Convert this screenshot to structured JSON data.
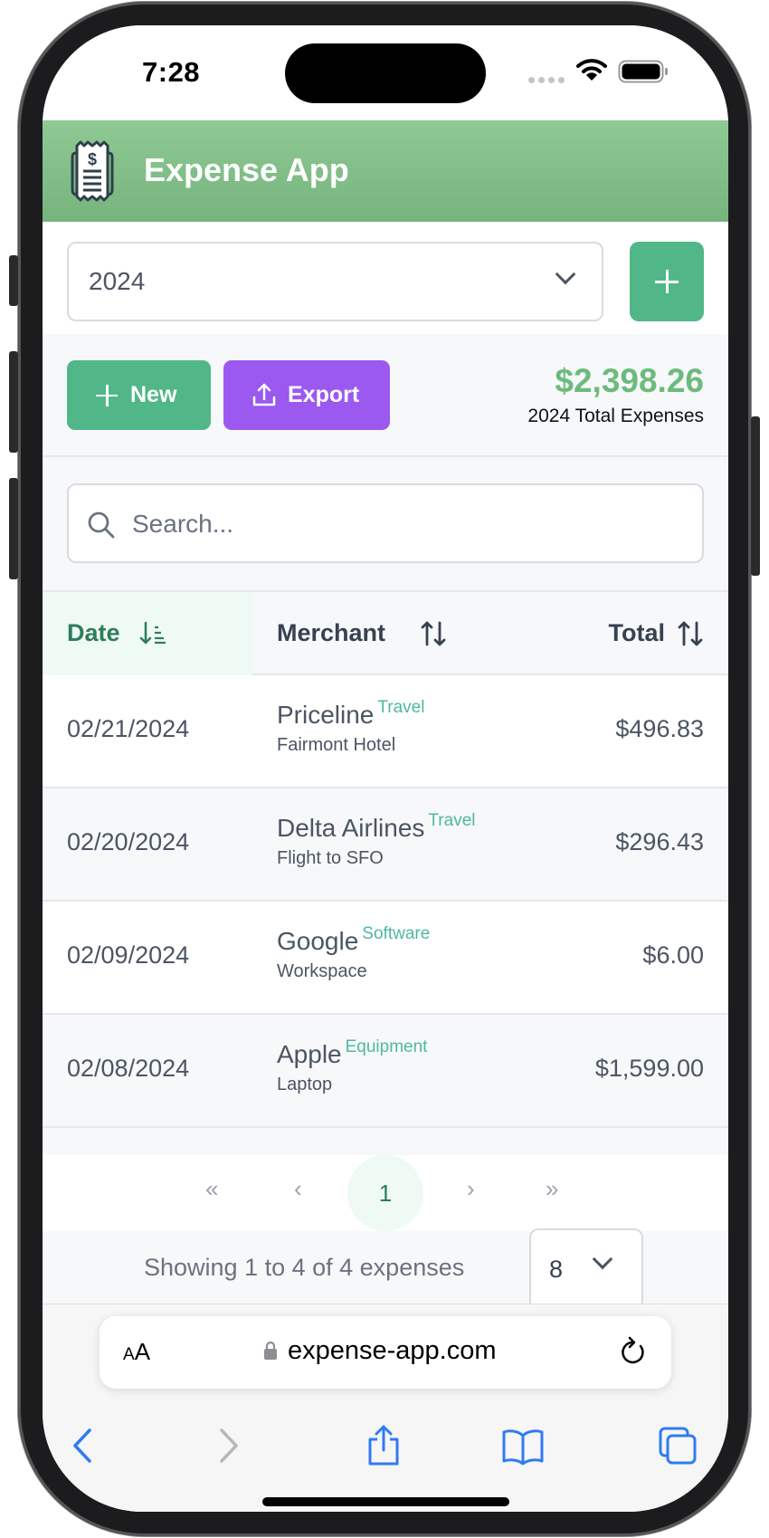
{
  "status_bar": {
    "time": "7:28"
  },
  "header": {
    "title": "Expense App",
    "logo_icon": "receipt-dollar-icon"
  },
  "year_filter": {
    "selected": "2024",
    "add_button_icon": "plus-icon"
  },
  "actions": {
    "new_label": "New",
    "export_label": "Export",
    "total_amount": "$2,398.26",
    "total_label": "2024 Total Expenses"
  },
  "search": {
    "placeholder": "Search...",
    "value": ""
  },
  "table": {
    "columns": [
      {
        "label": "Date",
        "sort": "descending",
        "active": true
      },
      {
        "label": "Merchant",
        "sort": "none",
        "active": false
      },
      {
        "label": "Total",
        "sort": "none",
        "active": false
      }
    ],
    "rows": [
      {
        "date": "02/21/2024",
        "merchant": "Priceline",
        "category": "Travel",
        "description": "Fairmont Hotel",
        "total": "$496.83"
      },
      {
        "date": "02/20/2024",
        "merchant": "Delta Airlines",
        "category": "Travel",
        "description": "Flight to SFO",
        "total": "$296.43"
      },
      {
        "date": "02/09/2024",
        "merchant": "Google",
        "category": "Software",
        "description": "Workspace",
        "total": "$6.00"
      },
      {
        "date": "02/08/2024",
        "merchant": "Apple",
        "category": "Equipment",
        "description": "Laptop",
        "total": "$1,599.00"
      }
    ]
  },
  "pagination": {
    "first": "«",
    "prev": "‹",
    "current_page": "1",
    "next": "›",
    "last": "»",
    "summary": "Showing 1 to 4 of 4 expenses",
    "page_size": "8"
  },
  "browser": {
    "text_size_label_small": "A",
    "text_size_label_large": "A",
    "url": "expense-app.com"
  },
  "colors": {
    "brand_green": "#52b788",
    "header_green": "#8fc994",
    "export_purple": "#9b59ef",
    "total_green": "#6dbb7c",
    "category_teal": "#4fb89f",
    "safari_blue": "#2f7bf5"
  }
}
